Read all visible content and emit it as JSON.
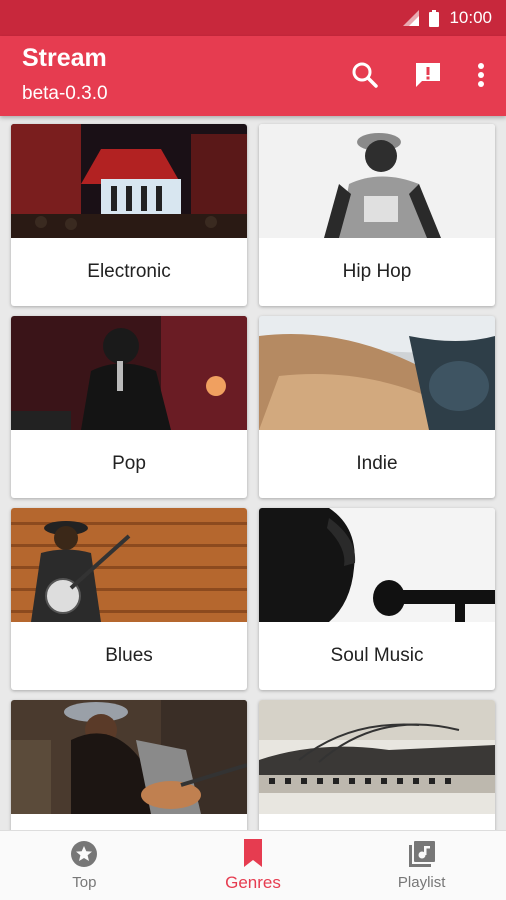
{
  "status_bar": {
    "time": "10:00"
  },
  "app_bar": {
    "title": "Stream",
    "subtitle": "beta-0.3.0",
    "icons": [
      "search-icon",
      "feedback-icon",
      "more-vert-icon"
    ]
  },
  "genres": [
    {
      "label": "Electronic"
    },
    {
      "label": "Hip Hop"
    },
    {
      "label": "Pop"
    },
    {
      "label": "Indie"
    },
    {
      "label": "Blues"
    },
    {
      "label": "Soul Music"
    },
    {
      "label": ""
    },
    {
      "label": ""
    }
  ],
  "bottom_nav": {
    "items": [
      {
        "label": "Top",
        "icon": "star-icon"
      },
      {
        "label": "Genres",
        "icon": "bookmark-icon"
      },
      {
        "label": "Playlist",
        "icon": "playlist-icon"
      }
    ],
    "active": "Genres"
  },
  "colors": {
    "primary": "#e63c50",
    "status_bar": "#c8283c"
  }
}
